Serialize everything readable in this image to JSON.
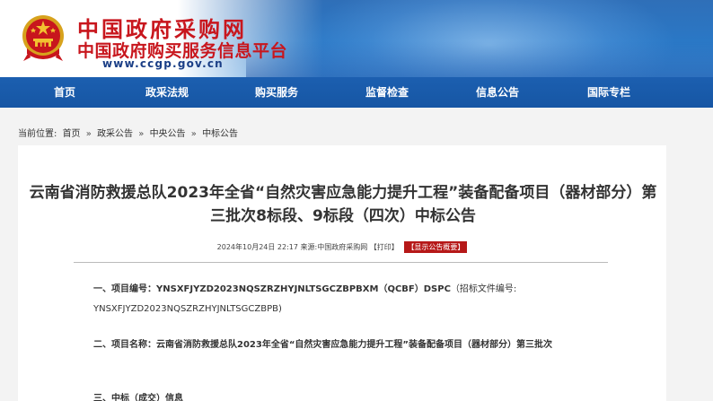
{
  "header": {
    "logo_line1": "中国政府采购网",
    "logo_line2": "中国政府购买服务信息平台",
    "logo_url": "www.ccgp.gov.cn",
    "emblem_icon": "national-emblem-icon",
    "accent_color": "#c8161d"
  },
  "nav": {
    "items": [
      "首页",
      "政采法规",
      "购买服务",
      "监督检查",
      "信息公告",
      "国际专栏"
    ],
    "color": "#1656a4"
  },
  "breadcrumb": {
    "prefix": "当前位置:",
    "items": [
      "首页",
      "政采公告",
      "中央公告",
      "中标公告"
    ],
    "separator": "»"
  },
  "article": {
    "title": "云南省消防救援总队2023年全省“自然灾害应急能力提升工程”装备配备项目（器材部分）第三批次8标段、9标段（四次）中标公告",
    "meta": {
      "date": "2024年10月24日 22:17",
      "source_label": "来源:",
      "source": "中国政府采购网",
      "print": "【打印】",
      "badge": "【显示公告概要】"
    },
    "sections": [
      {
        "label": "一、项目编号：",
        "value": "YNSXFJYZD2023NQSZRZHYJNLTSGCZBPBXM（QCBF）DSPC",
        "note": "（招标文件编号: YNSXFJYZD2023NQSZRZHYJNLTSGCZBPB)"
      },
      {
        "label": "二、项目名称：",
        "value": "云南省消防救援总队2023年全省“自然灾害应急能力提升工程”装备配备项目（器材部分）第三批次"
      },
      {
        "label": "三、中标（成交）信息"
      }
    ]
  }
}
